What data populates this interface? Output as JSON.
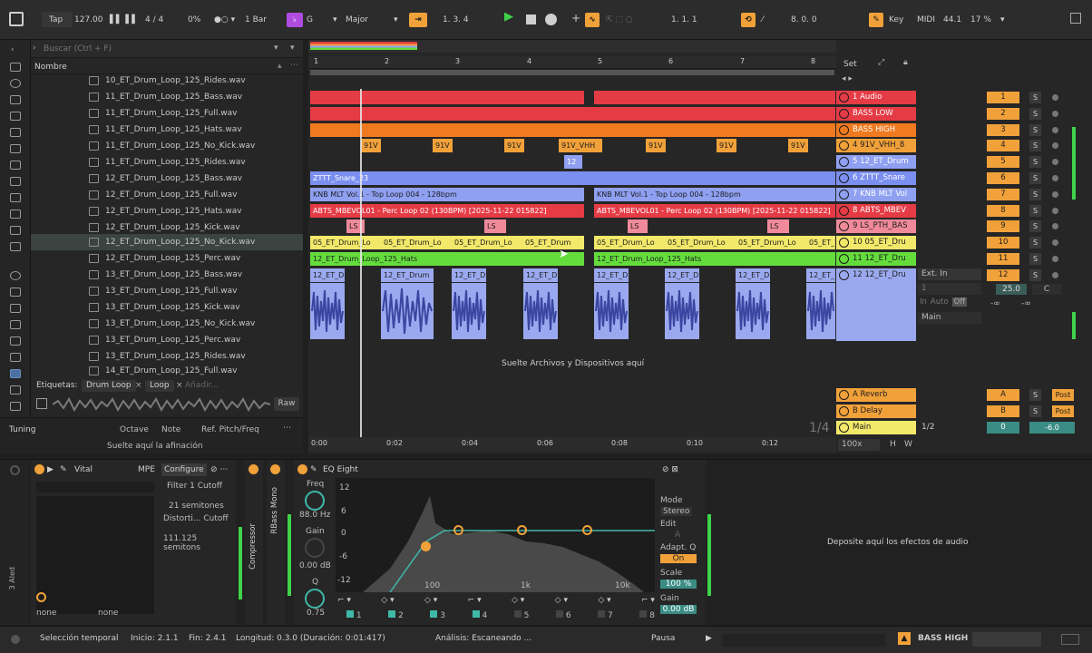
{
  "transport": {
    "tap": "Tap",
    "bpm": "127.00",
    "time_sig": "4 / 4",
    "swing": "0%",
    "quantize": "1 Bar",
    "key_note": "G",
    "scale": "Major",
    "position": "1.   3.   4",
    "loop_start": "1.   1.   1",
    "loop_length": "8.   0.   0",
    "key_label": "Key",
    "midi_label": "MIDI",
    "sample_rate": "44.1",
    "cpu": "17 %"
  },
  "browser": {
    "search_placeholder": "Buscar (Ctrl + F)",
    "column_header": "Nombre",
    "files": [
      "10_ET_Drum_Loop_125_Rides.wav",
      "11_ET_Drum_Loop_125_Bass.wav",
      "11_ET_Drum_Loop_125_Full.wav",
      "11_ET_Drum_Loop_125_Hats.wav",
      "11_ET_Drum_Loop_125_No_Kick.wav",
      "11_ET_Drum_Loop_125_Rides.wav",
      "12_ET_Drum_Loop_125_Bass.wav",
      "12_ET_Drum_Loop_125_Full.wav",
      "12_ET_Drum_Loop_125_Hats.wav",
      "12_ET_Drum_Loop_125_Kick.wav",
      "12_ET_Drum_Loop_125_No_Kick.wav",
      "12_ET_Drum_Loop_125_Perc.wav",
      "13_ET_Drum_Loop_125_Bass.wav",
      "13_ET_Drum_Loop_125_Full.wav",
      "13_ET_Drum_Loop_125_Kick.wav",
      "13_ET_Drum_Loop_125_No_Kick.wav",
      "13_ET_Drum_Loop_125_Perc.wav",
      "13_ET_Drum_Loop_125_Rides.wav",
      "14_ET_Drum_Loop_125_Full.wav"
    ],
    "selected_file": "12_ET_Drum_Loop_125_No_Kick.wav",
    "tags_label": "Etiquetas:",
    "tags": [
      "Drum Loop",
      "Loop"
    ],
    "tag_add": "Añadir...",
    "raw_label": "Raw"
  },
  "tuning": {
    "title": "Tuning",
    "octave": "Octave",
    "note": "Note",
    "ref": "Ref. Pitch/Freq",
    "hint": "Suelte aquí la afinación"
  },
  "arrangement": {
    "set_label": "Set",
    "bars": [
      "1",
      "2",
      "3",
      "4",
      "5",
      "6",
      "7",
      "8"
    ],
    "times": [
      "0:00",
      "0:02",
      "0:04",
      "0:06",
      "0:08",
      "0:10",
      "0:12"
    ],
    "drop_hint": "Suelte Archivos y Dispositivos aquí",
    "page": "1/4",
    "zoom": "100x",
    "clip_labels": {
      "r4": "91V",
      "r4b": "91V_VHH",
      "r5": "12",
      "r6": "ZTTT_Snare_23",
      "r7": "KNB MLT Vol.1 - Top Loop 004 - 128bpm",
      "r8": "ABTS_MBEVOL01 - Perc Loop 02 (130BPM) [2025-11-22 015822]",
      "r9": "LS",
      "r10": "05_ET_Drum_Lo",
      "r10b": "05_ET_Drum",
      "r11": "12_ET_Drum_Loop_125_Hats",
      "r12": "12_ET_Drum"
    },
    "tracks": [
      {
        "name": "1 Audio",
        "num": "1",
        "color": "#e53b45"
      },
      {
        "name": "BASS LOW",
        "num": "2",
        "color": "#e53b45"
      },
      {
        "name": "BASS HIGH",
        "num": "3",
        "color": "#f07a1f"
      },
      {
        "name": "4 91V_VHH_8",
        "num": "4",
        "color": "#f1a13a"
      },
      {
        "name": "5 12_ET_Drum",
        "num": "5",
        "color": "#8fa0f2"
      },
      {
        "name": "6 ZTTT_Snare",
        "num": "6",
        "color": "#7b8ff0"
      },
      {
        "name": "7 KNB MLT Vol",
        "num": "7",
        "color": "#8fa0f2"
      },
      {
        "name": "8 ABTS_MBEV",
        "num": "8",
        "color": "#e53b45"
      },
      {
        "name": "9 LS_PTH_BAS",
        "num": "9",
        "color": "#f08a9a"
      },
      {
        "name": "10 05_ET_Dru",
        "num": "10",
        "color": "#f2e86a"
      },
      {
        "name": "11 12_ET_Dru",
        "num": "11",
        "color": "#64dd3c"
      },
      {
        "name": "12 12_ET_Dru",
        "num": "12",
        "color": "#9aa9ef"
      }
    ],
    "sel_track": {
      "input": "Ext. In",
      "channel": "1",
      "mode_in": "In",
      "mode_auto": "Auto",
      "mode_off": "Off",
      "output": "Main",
      "volume": "25.0",
      "pan": "C",
      "send_a": "-∞",
      "send_b": "-∞"
    },
    "returns": [
      {
        "name": "A Reverb",
        "num": "A",
        "color": "#f1a13a",
        "post": "Post"
      },
      {
        "name": "B Delay",
        "num": "B",
        "color": "#f1a13a",
        "post": "Post"
      }
    ],
    "master": {
      "name": "Main",
      "ratio": "1/2",
      "vol": "0",
      "pan": "-6.0"
    },
    "solo": "S",
    "h_btn": "H",
    "w_btn": "W"
  },
  "devices": {
    "vital": {
      "title": "Vital",
      "mpe": "MPE",
      "configure": "Configure",
      "param1": "Filter 1 Cutoff",
      "val1": "21 semitones",
      "param2": "Distorti... Cutoff",
      "val2": "111.125 semitons",
      "sel1": "none",
      "sel2": "none",
      "side_label": "3 Aled"
    },
    "compressor": "Compressor",
    "rbass": "RBass Mono",
    "eq": {
      "title": "EQ Eight",
      "freq": "Freq",
      "freq_val": "88.0 Hz",
      "gain": "Gain",
      "gain_val": "0.00 dB",
      "q": "Q",
      "q_val": "0.75",
      "db_ticks": [
        "12",
        "6",
        "0",
        "-6",
        "-12"
      ],
      "freq_ticks": [
        "100",
        "1k",
        "10k"
      ],
      "mode": "Mode",
      "mode_val": "Stereo",
      "edit": "Edit",
      "edit_val": "A",
      "adapt": "Adapt. Q",
      "adapt_val": "On",
      "scale": "Scale",
      "scale_val": "100 %",
      "gain_label": "Gain",
      "gain_out": "0.00 dB",
      "bands": [
        "1",
        "2",
        "3",
        "4",
        "5",
        "6",
        "7",
        "8"
      ]
    },
    "audio_drop": "Deposite aquí los efectos de audio"
  },
  "status": {
    "mode": "Selección temporal",
    "start": "Inicio: 2.1.1",
    "end": "Fin: 2.4.1",
    "length": "Longitud: 0.3.0 (Duración: 0:01:417)",
    "analysis": "Análisis: Escaneando ...",
    "pause": "Pausa",
    "track": "BASS HIGH"
  }
}
